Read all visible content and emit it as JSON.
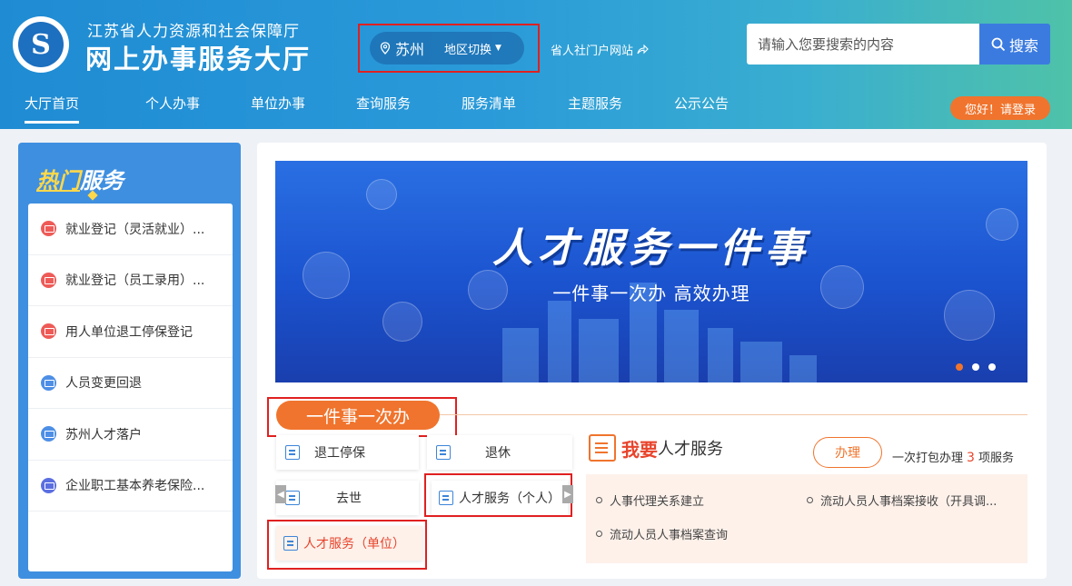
{
  "header": {
    "org_name": "江苏省人力资源和社会保障厅",
    "title": "网上办事服务大厅",
    "region_city": "苏州",
    "region_switch": "地区切换",
    "portal_link": "省人社门户网站",
    "search_placeholder": "请输入您要搜索的内容",
    "search_button": "搜索",
    "login": "您好！请登录"
  },
  "nav": {
    "items": [
      "大厅首页",
      "个人办事",
      "单位办事",
      "查询服务",
      "服务清单",
      "主题服务",
      "公示公告"
    ],
    "active": "大厅首页"
  },
  "sidebar": {
    "title_hot": "热门",
    "title_rest": "服务",
    "items": [
      "就业登记（灵活就业）...",
      "就业登记（员工录用）...",
      "用人单位退工停保登记",
      "人员变更回退",
      "苏州人才落户",
      "企业职工基本养老保险..."
    ]
  },
  "banner": {
    "title": "人才服务一件事",
    "subtitle": "一件事一次办 高效办理"
  },
  "section": {
    "title": "一件事一次办",
    "tiles": [
      "退工停保",
      "退休",
      "去世",
      "人才服务（个人）",
      "人才服务（单位）"
    ]
  },
  "service": {
    "want": "我要",
    "name": "人才服务",
    "do_button": "办理",
    "pack_prefix": "一次打包办理",
    "pack_count": "3",
    "pack_suffix": "项服务",
    "items": [
      "人事代理关系建立",
      "流动人员人事档案接收（开具调...",
      "流动人员人事档案查询"
    ]
  },
  "colors": {
    "accent": "#f0742d",
    "primary": "#3b7be0",
    "highlight_box": "#e02020"
  }
}
